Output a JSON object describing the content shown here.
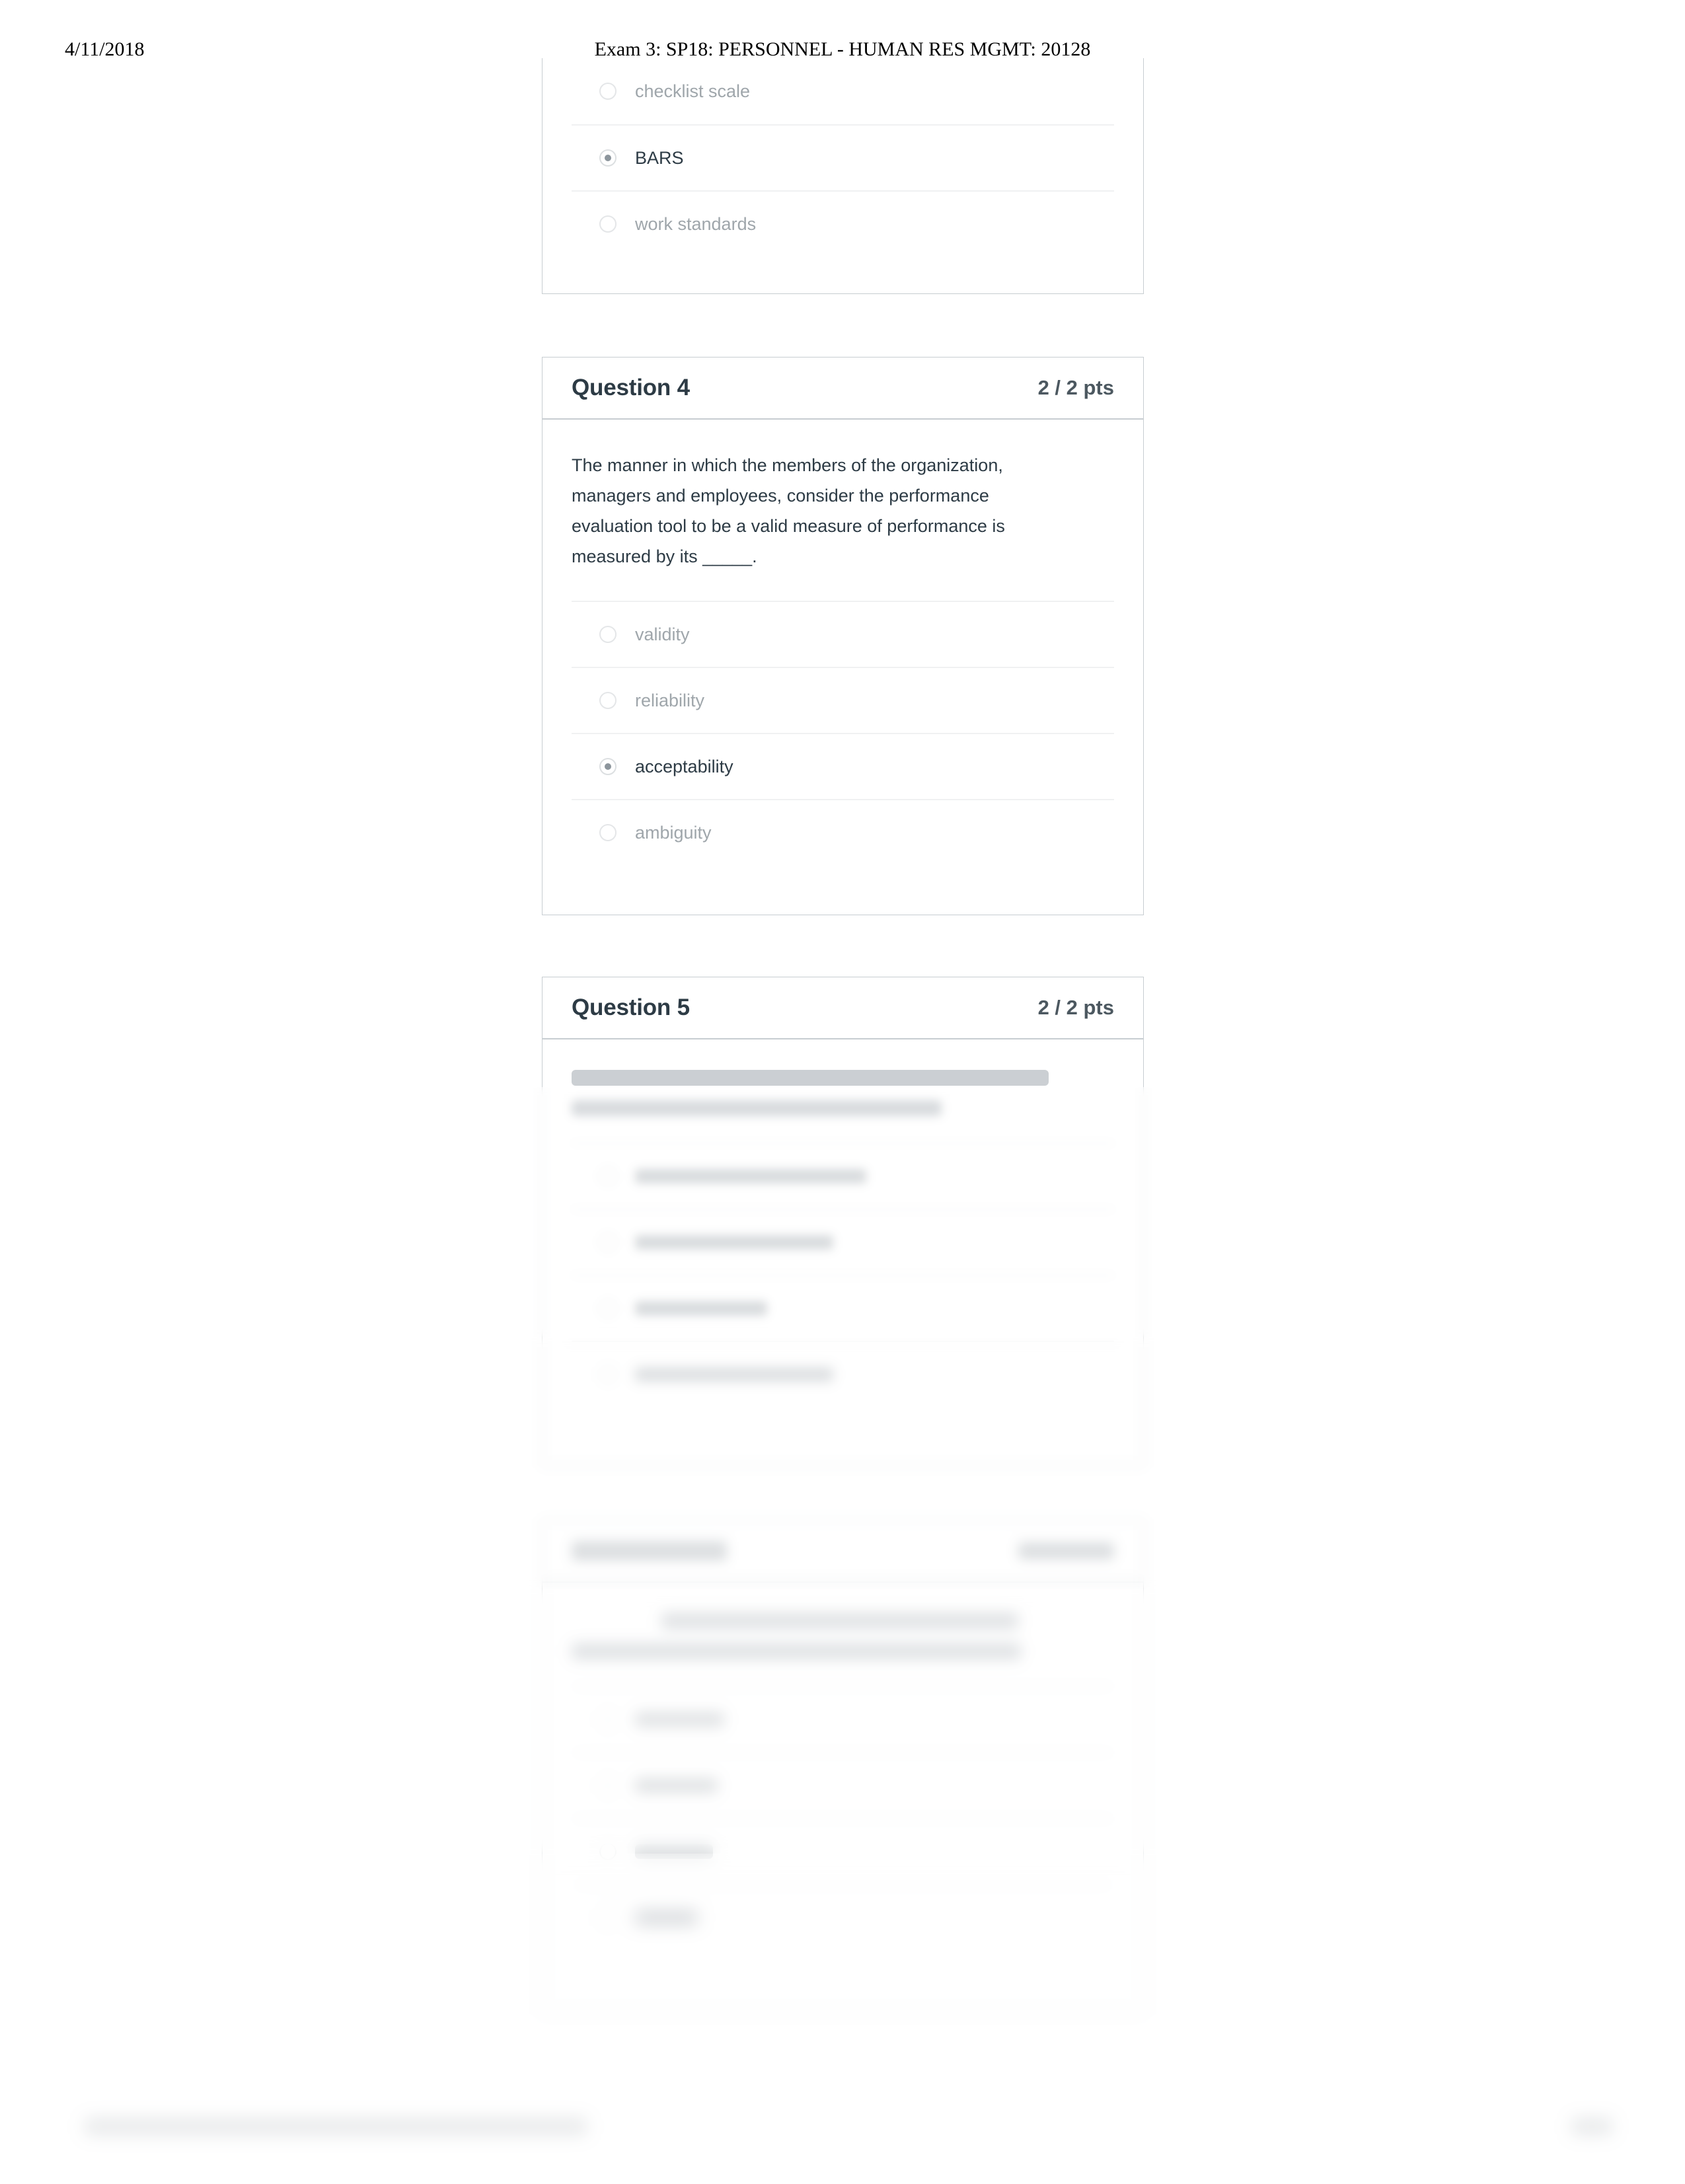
{
  "print_header": {
    "date": "4/11/2018",
    "title": "Exam 3: SP18: PERSONNEL - HUMAN RES MGMT: 20128"
  },
  "colors": {
    "card_border": "#c7cdd1",
    "heading_text": "#2d3b45",
    "points_text": "#4c5860",
    "unselected_option_text": "#9fa6ab",
    "divider": "#f0f1f2",
    "radio_dot": "#8c959c",
    "page_background": "#ffffff"
  },
  "questions": [
    {
      "id": "q3-partial",
      "header_visible": false,
      "title": "",
      "points": "",
      "text": "",
      "options": [
        {
          "label": "checklist scale",
          "selected": false,
          "blurred": false
        },
        {
          "label": "BARS",
          "selected": true,
          "blurred": false
        },
        {
          "label": "work standards",
          "selected": false,
          "blurred": false
        }
      ]
    },
    {
      "id": "q4",
      "header_visible": true,
      "title": "Question 4",
      "points": "2 / 2 pts",
      "text": "The manner in which the members of the organization, managers and employees, consider the performance evaluation tool to be a valid measure of performance is measured by its _____.",
      "options": [
        {
          "label": "validity",
          "selected": false,
          "blurred": false
        },
        {
          "label": "reliability",
          "selected": false,
          "blurred": false
        },
        {
          "label": "acceptability",
          "selected": true,
          "blurred": false
        },
        {
          "label": "ambiguity",
          "selected": false,
          "blurred": false
        }
      ]
    },
    {
      "id": "q5",
      "header_visible": true,
      "title": "Question 5",
      "points": "2 / 2 pts",
      "text": "",
      "text_blurred": true,
      "options": [
        {
          "label": "",
          "selected": true,
          "blurred": true
        },
        {
          "label": "",
          "selected": false,
          "blurred": true
        },
        {
          "label": "",
          "selected": false,
          "blurred": true
        },
        {
          "label": "",
          "selected": false,
          "blurred": true
        }
      ]
    },
    {
      "id": "q6",
      "header_visible": true,
      "header_blurred": true,
      "title": "Question 6",
      "points": "2 / 2 pts",
      "text": "",
      "text_blurred": true,
      "options": [
        {
          "label": "",
          "selected": false,
          "blurred": true
        },
        {
          "label": "",
          "selected": false,
          "blurred": true
        },
        {
          "label": "",
          "selected": false,
          "blurred": true
        },
        {
          "label": "",
          "selected": true,
          "blurred": true
        }
      ]
    }
  ],
  "print_footer": {
    "url": "",
    "page_number": ""
  }
}
